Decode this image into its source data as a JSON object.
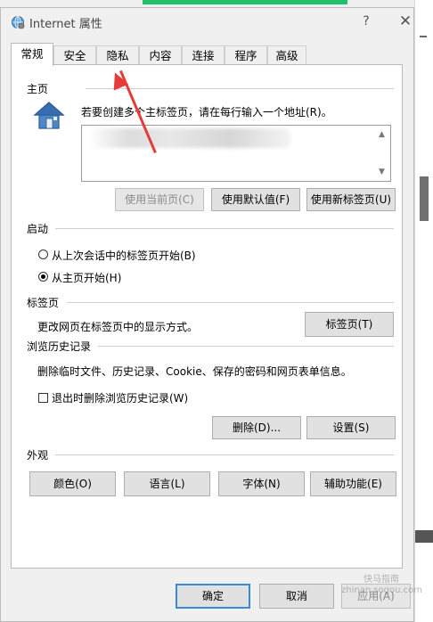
{
  "window": {
    "title": "Internet 属性",
    "help_label": "?",
    "close_label": "✕",
    "icon": "globe-gear-icon"
  },
  "tabs": [
    {
      "label": "常规",
      "active": true
    },
    {
      "label": "安全",
      "active": false
    },
    {
      "label": "隐私",
      "active": false
    },
    {
      "label": "内容",
      "active": false
    },
    {
      "label": "连接",
      "active": false
    },
    {
      "label": "程序",
      "active": false
    },
    {
      "label": "高级",
      "active": false
    }
  ],
  "home_page": {
    "section_label": "主页",
    "description": "若要创建多个主标签页，请在每行输入一个地址(R)。",
    "url_value": "",
    "btn_use_current": "使用当前页(C)",
    "btn_use_default": "使用默认值(F)",
    "btn_use_new_tab": "使用新标签页(U)",
    "icon": "house-icon"
  },
  "startup": {
    "section_label": "启动",
    "option_last_session": "从上次会话中的标签页开始(B)",
    "option_home_page": "从主页开始(H)",
    "selected": "home_page"
  },
  "tabs_section": {
    "section_label": "标签页",
    "description": "更改网页在标签页中的显示方式。",
    "btn_tabs": "标签页(T)"
  },
  "history": {
    "section_label": "浏览历史记录",
    "description": "删除临时文件、历史记录、Cookie、保存的密码和网页表单信息。",
    "checkbox_delete_on_exit": "退出时删除浏览历史记录(W)",
    "checked": false,
    "btn_delete": "删除(D)...",
    "btn_settings": "设置(S)"
  },
  "appearance": {
    "section_label": "外观",
    "btn_colors": "颜色(O)",
    "btn_languages": "语言(L)",
    "btn_fonts": "字体(N)",
    "btn_accessibility": "辅助功能(E)"
  },
  "footer": {
    "btn_ok": "确定",
    "btn_cancel": "取消",
    "btn_apply": "应用(A)"
  },
  "watermark": {
    "line1": "快马指南",
    "line2": "zhinan.sogou.com"
  },
  "colors": {
    "annotation_arrow": "#e53b3b",
    "top_accent": "#21c16b",
    "focus_border": "#3b8ad8"
  }
}
